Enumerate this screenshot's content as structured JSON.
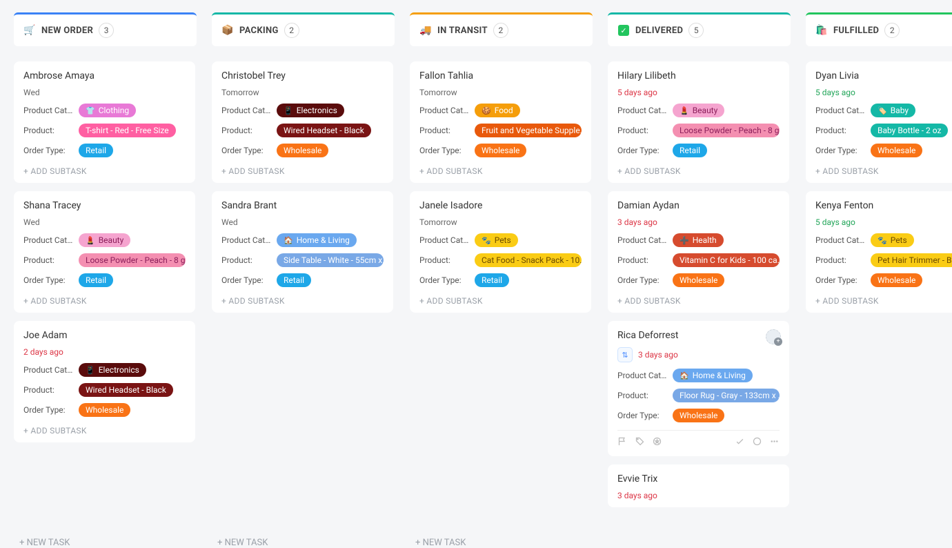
{
  "labels": {
    "product_cat": "Product Cat...",
    "product": "Product:",
    "order_type": "Order Type:",
    "add_subtask": "+ ADD SUBTASK",
    "new_task": "+ NEW TASK"
  },
  "columns": [
    {
      "id": "neworder",
      "title": "NEW ORDER",
      "count": "3",
      "icon": "🛒",
      "new_task": true,
      "cards": [
        {
          "name": "Ambrose Amaya",
          "date": "Wed",
          "date_style": "",
          "category": {
            "text": "Clothing",
            "class": "bg-clothing",
            "emoji": "👕"
          },
          "product": {
            "text": "T-shirt - Red - Free Size",
            "class": "bg-tshirt"
          },
          "order": {
            "text": "Retail",
            "class": "bg-retail"
          }
        },
        {
          "name": "Shana Tracey",
          "date": "Wed",
          "date_style": "",
          "category": {
            "text": "Beauty",
            "class": "bg-beauty",
            "emoji": "💄"
          },
          "product": {
            "text": "Loose Powder - Peach - 8 g...",
            "class": "bg-powder"
          },
          "order": {
            "text": "Retail",
            "class": "bg-retail"
          }
        },
        {
          "name": "Joe Adam",
          "date": "2 days ago",
          "date_style": "overdue",
          "category": {
            "text": "Electronics",
            "class": "bg-electronics",
            "emoji": "📱"
          },
          "product": {
            "text": "Wired Headset - Black",
            "class": "bg-headset"
          },
          "order": {
            "text": "Wholesale",
            "class": "bg-wholesale"
          }
        }
      ]
    },
    {
      "id": "packing",
      "title": "PACKING",
      "count": "2",
      "icon": "📦",
      "new_task": true,
      "cards": [
        {
          "name": "Christobel Trey",
          "date": "Tomorrow",
          "date_style": "",
          "category": {
            "text": "Electronics",
            "class": "bg-electronics",
            "emoji": "📱"
          },
          "product": {
            "text": "Wired Headset - Black",
            "class": "bg-headset"
          },
          "order": {
            "text": "Wholesale",
            "class": "bg-wholesale"
          }
        },
        {
          "name": "Sandra Brant",
          "date": "Wed",
          "date_style": "",
          "category": {
            "text": "Home & Living",
            "class": "bg-home",
            "emoji": "🏠"
          },
          "product": {
            "text": "Side Table - White - 55cm x...",
            "class": "bg-sidetable"
          },
          "order": {
            "text": "Retail",
            "class": "bg-retail"
          }
        }
      ]
    },
    {
      "id": "intransit",
      "title": "IN TRANSIT",
      "count": "2",
      "icon": "🚚",
      "new_task": true,
      "cards": [
        {
          "name": "Fallon Tahlia",
          "date": "Tomorrow",
          "date_style": "",
          "category": {
            "text": "Food",
            "class": "bg-food",
            "emoji": "🍪"
          },
          "product": {
            "text": "Fruit and Vegetable Supple...",
            "class": "bg-fruit"
          },
          "order": {
            "text": "Wholesale",
            "class": "bg-wholesale"
          }
        },
        {
          "name": "Janele Isadore",
          "date": "Tomorrow",
          "date_style": "",
          "category": {
            "text": "Pets",
            "class": "bg-pets",
            "emoji": "🐾"
          },
          "product": {
            "text": "Cat Food - Snack Pack - 10...",
            "class": "bg-catfood"
          },
          "order": {
            "text": "Retail",
            "class": "bg-retail"
          }
        }
      ]
    },
    {
      "id": "delivered",
      "title": "DELIVERED",
      "count": "5",
      "icon": "check",
      "new_task": false,
      "scrollbar": true,
      "cards": [
        {
          "name": "Hilary Lilibeth",
          "date": "5 days ago",
          "date_style": "overdue",
          "category": {
            "text": "Beauty",
            "class": "bg-beauty",
            "emoji": "💄"
          },
          "product": {
            "text": "Loose Powder - Peach - 8 g...",
            "class": "bg-powder"
          },
          "order": {
            "text": "Retail",
            "class": "bg-retail"
          }
        },
        {
          "name": "Damian Aydan",
          "date": "3 days ago",
          "date_style": "overdue",
          "category": {
            "text": "Health",
            "class": "bg-health",
            "emoji": "➕"
          },
          "product": {
            "text": "Vitamin C for Kids - 100 ca...",
            "class": "bg-vitaminc"
          },
          "order": {
            "text": "Wholesale",
            "class": "bg-wholesale"
          }
        },
        {
          "name": "Rica Deforrest",
          "date": "3 days ago",
          "date_style": "overdue",
          "date_icon": true,
          "active": true,
          "category": {
            "text": "Home & Living",
            "class": "bg-home",
            "emoji": "🏠"
          },
          "product": {
            "text": "Floor Rug - Gray - 133cm x ...",
            "class": "bg-floorrug"
          },
          "order": {
            "text": "Wholesale",
            "class": "bg-wholesale"
          }
        },
        {
          "name": "Evvie Trix",
          "date": "3 days ago",
          "date_style": "overdue",
          "partial": true
        }
      ]
    },
    {
      "id": "fulfilled",
      "title": "FULFILLED",
      "count": "2",
      "icon": "🛍️",
      "new_task": false,
      "cards": [
        {
          "name": "Dyan Livia",
          "date": "5 days ago",
          "date_style": "green",
          "category": {
            "text": "Baby",
            "class": "bg-baby",
            "emoji": "🏷️"
          },
          "product": {
            "text": "Baby Bottle - 2 oz",
            "class": "bg-bottle"
          },
          "order": {
            "text": "Wholesale",
            "class": "bg-wholesale"
          }
        },
        {
          "name": "Kenya Fenton",
          "date": "5 days ago",
          "date_style": "green",
          "category": {
            "text": "Pets",
            "class": "bg-pets",
            "emoji": "🐾"
          },
          "product": {
            "text": "Pet Hair Trimmer - Blue",
            "class": "bg-pettrim"
          },
          "order": {
            "text": "Wholesale",
            "class": "bg-wholesale"
          }
        }
      ]
    }
  ]
}
